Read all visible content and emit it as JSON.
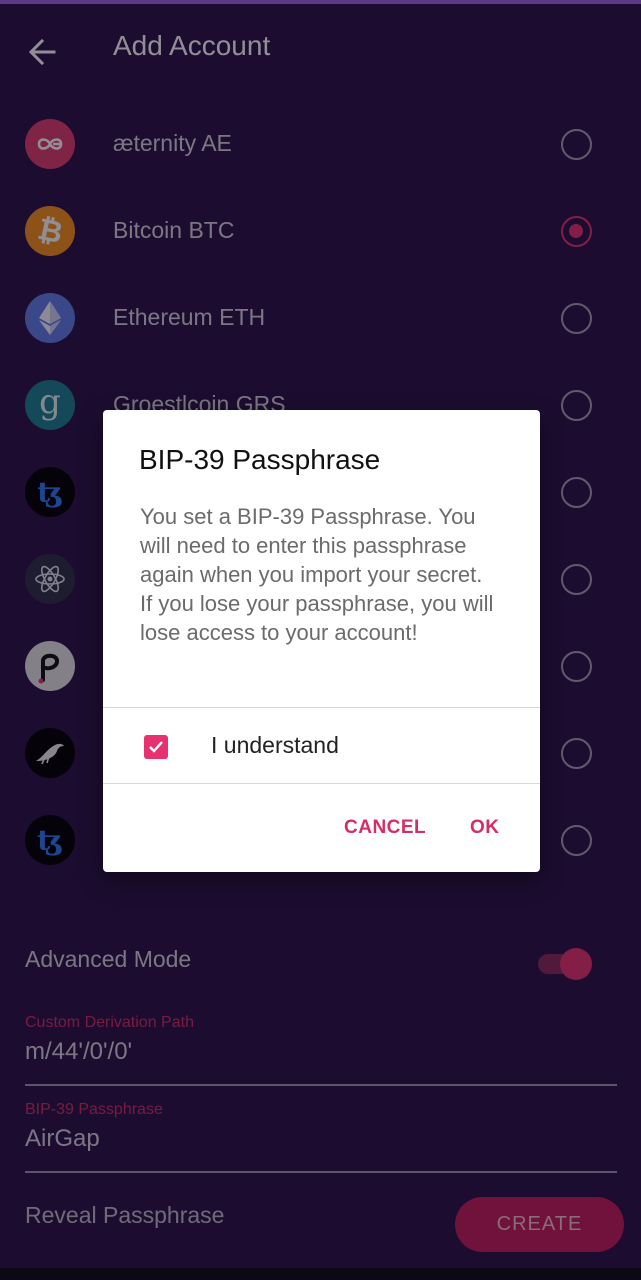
{
  "header": {
    "title": "Add Account",
    "back_icon": "arrow-left-icon"
  },
  "coins": [
    {
      "name": "æternity",
      "symbol": "AE",
      "icon": "aeternity-icon",
      "color": "#de3e6e",
      "selected": false
    },
    {
      "name": "Bitcoin",
      "symbol": "BTC",
      "icon": "bitcoin-icon",
      "color": "#f7931a",
      "selected": true
    },
    {
      "name": "Ethereum",
      "symbol": "ETH",
      "icon": "ethereum-icon",
      "color": "#627eea",
      "selected": false
    },
    {
      "name": "Groestlcoin",
      "symbol": "GRS",
      "icon": "groestlcoin-icon",
      "color": "#1d8292",
      "selected": false
    },
    {
      "name": "",
      "symbol": "",
      "icon": "tezos-icon",
      "color": "#000000",
      "selected": false
    },
    {
      "name": "",
      "symbol": "",
      "icon": "cosmos-icon",
      "color": "#2e3148",
      "selected": false
    },
    {
      "name": "",
      "symbol": "",
      "icon": "polkadot-icon",
      "color": "#e6e6e6",
      "selected": false
    },
    {
      "name": "",
      "symbol": "",
      "icon": "kusama-icon",
      "color": "#000000",
      "selected": false
    },
    {
      "name": "",
      "symbol": "",
      "icon": "tezos-icon",
      "color": "#000000",
      "selected": false
    }
  ],
  "advanced": {
    "label": "Advanced Mode",
    "enabled": true
  },
  "derivation": {
    "label": "Custom Derivation Path",
    "value": "m/44'/0'/0'"
  },
  "passphrase": {
    "label": "BIP-39 Passphrase",
    "value": "AirGap"
  },
  "reveal": {
    "label": "Reveal Passphrase"
  },
  "create": {
    "label": "CREATE"
  },
  "dialog": {
    "title": "BIP-39 Passphrase",
    "body": "You set a BIP-39 Passphrase. You will need to enter this passphrase again when you import your secret. If you lose your passphrase, you will lose access to your account!",
    "checkbox_label": "I understand",
    "checkbox_checked": true,
    "cancel": "CANCEL",
    "ok": "OK"
  },
  "colors": {
    "background": "#2a1547",
    "accent": "#e6336f",
    "button": "#c41e5d"
  }
}
